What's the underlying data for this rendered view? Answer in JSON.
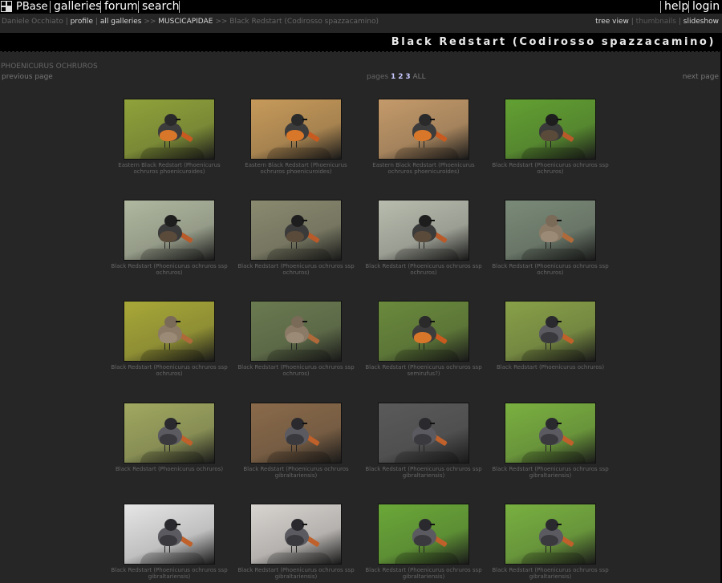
{
  "nav": {
    "logo_text": "PBase",
    "items": [
      "galleries",
      "forum",
      "search"
    ],
    "right_items": [
      "help",
      "login"
    ]
  },
  "breadcrumb": {
    "user": "Daniele Occhiato",
    "profile": "profile",
    "all_galleries": "all galleries",
    "parent": "MUSCICAPIDAE",
    "current": "Black Redstart (Codirosso spazzacamino)"
  },
  "views": {
    "tree": "tree view",
    "thumbnails": "thumbnails",
    "slideshow": "slideshow"
  },
  "gallery_title": "Black Redstart (Codirosso spazzacamino)",
  "category": "PHOENICURUS OCHRUROS",
  "pager": {
    "previous": "previous page",
    "label": "pages",
    "pages": [
      "1",
      "2",
      "3"
    ],
    "all": "ALL",
    "next": "next page"
  },
  "thumbnails": [
    {
      "caption": "Eastern Black Redstart (Phoenicurus ochruros phoenicuroides)",
      "bg": "#8fa23a",
      "bird": "male-orange"
    },
    {
      "caption": "Eastern Black Redstart (Phoenicurus ochruros phoenicuroides)",
      "bg": "#c79a5a",
      "bird": "male-orange"
    },
    {
      "caption": "Eastern Black Redstart (Phoenicurus ochruros phoenicuroides)",
      "bg": "#c49a6a",
      "bird": "male-orange"
    },
    {
      "caption": "Black Redstart (Phoenicurus ochruros ssp ochruros)",
      "bg": "#62a032",
      "bird": "male-dark"
    },
    {
      "caption": "Black Redstart (Phoenicurus ochruros ssp ochruros)",
      "bg": "#b0b8a0",
      "bird": "male-dark"
    },
    {
      "caption": "Black Redstart (Phoenicurus ochruros ssp ochruros)",
      "bg": "#8a8a70",
      "bird": "male-dark"
    },
    {
      "caption": "Black Redstart (Phoenicurus ochruros ssp ochruros)",
      "bg": "#b8bcae",
      "bird": "male-dark"
    },
    {
      "caption": "Black Redstart (Phoenicurus ochruros ssp ochruros)",
      "bg": "#7a8a78",
      "bird": "female"
    },
    {
      "caption": "Black Redstart (Phoenicurus ochruros ssp ochruros)",
      "bg": "#a8a838",
      "bird": "female"
    },
    {
      "caption": "Black Redstart (Phoenicurus ochruros ssp ochruros)",
      "bg": "#6a7a50",
      "bird": "female"
    },
    {
      "caption": "Black Redstart (Phoenicurus ochruros ssp semirufus?)",
      "bg": "#6a8a3c",
      "bird": "male-orange"
    },
    {
      "caption": "Black Redstart (Phoenicurus ochruros)",
      "bg": "#88a048",
      "bird": "male-grey"
    },
    {
      "caption": "Black Redstart (Phoenicurus ochruros)",
      "bg": "#a0a860",
      "bird": "male-grey"
    },
    {
      "caption": "Black Redstart (Phoenicurus ochruros gibraltariensis)",
      "bg": "#8a6a4a",
      "bird": "male-grey"
    },
    {
      "caption": "Black Redstart (Phoenicurus ochruros ssp gibraltariensis)",
      "bg": "#5a5a5a",
      "bird": "male-grey"
    },
    {
      "caption": "Black Redstart (Phoenicurus ochruros ssp gibraltariensis)",
      "bg": "#7ab040",
      "bird": "male-grey"
    },
    {
      "caption": "Black Redstart (Phoenicurus ochruros ssp gibraltariensis)",
      "bg": "#e6e6e6",
      "bird": "male-grey"
    },
    {
      "caption": "Black Redstart (Phoenicurus ochruros ssp gibraltariensis)",
      "bg": "#d8d4d0",
      "bird": "male-grey"
    },
    {
      "caption": "Black Redstart (Phoenicurus ochruros ssp gibraltariensis)",
      "bg": "#6aa838",
      "bird": "male-grey"
    },
    {
      "caption": "Black Redstart (Phoenicurus ochruros ssp gibraltariensis)",
      "bg": "#78b040",
      "bird": "male-grey"
    }
  ]
}
